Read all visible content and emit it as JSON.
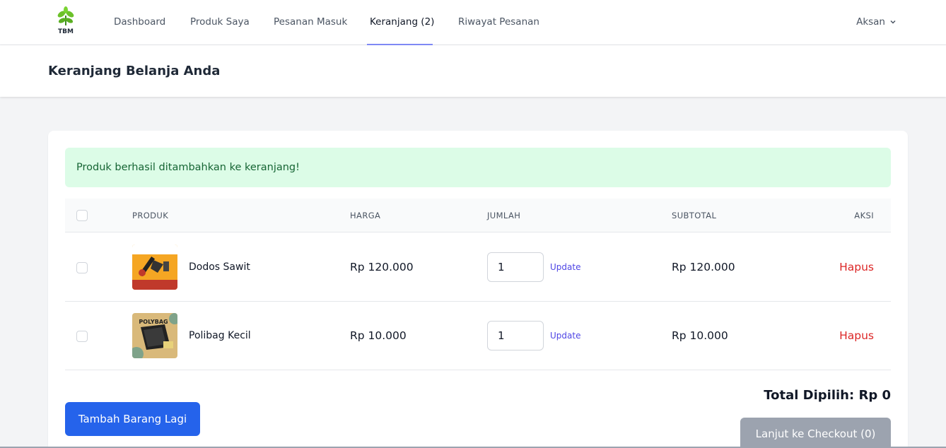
{
  "nav": {
    "logo_text": "TBM",
    "links": [
      "Dashboard",
      "Produk Saya",
      "Pesanan Masuk",
      "Keranjang (2)",
      "Riwayat Pesanan"
    ],
    "active": "Keranjang (2)",
    "user": "Aksan"
  },
  "header": {
    "title": "Keranjang Belanja Anda"
  },
  "alert": {
    "message": "Produk berhasil ditambahkan ke keranjang!"
  },
  "table": {
    "columns": [
      "PRODUK",
      "HARGA",
      "JUMLAH",
      "SUBTOTAL",
      "AKSI"
    ],
    "rows": [
      {
        "name": "Dodos Sawit",
        "price": "Rp 120.000",
        "qty": "1",
        "update": "Update",
        "subtotal": "Rp 120.000",
        "action": "Hapus",
        "thumb_text": ""
      },
      {
        "name": "Polibag Kecil",
        "price": "Rp 10.000",
        "qty": "1",
        "update": "Update",
        "subtotal": "Rp 10.000",
        "action": "Hapus",
        "thumb_text": "POLYBAG"
      }
    ]
  },
  "footer": {
    "total": "Total Dipilih: Rp 0",
    "add_button": "Tambah Barang Lagi",
    "checkout_button": "Lanjut ke Checkout (0)"
  },
  "colors": {
    "primary": "#2563eb",
    "danger": "#dc2626",
    "success_bg": "#dcfce7",
    "success_text": "#166534",
    "active_underline": "#818cf8"
  }
}
